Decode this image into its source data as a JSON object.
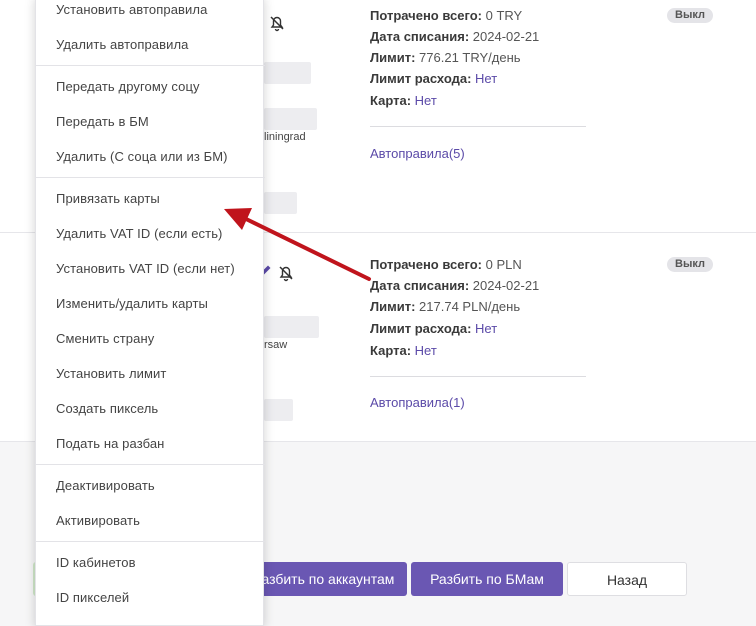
{
  "accounts": [
    {
      "spent_label": "Потрачено всего:",
      "spent_value": "0 TRY",
      "debit_label": "Дата списания:",
      "debit_value": "2024-02-21",
      "limit_label": "Лимит:",
      "limit_value": "776.21 TRY/день",
      "spend_limit_label": "Лимит расхода:",
      "spend_limit_value": "Нет",
      "card_label": "Карта:",
      "card_value": "Нет",
      "autorules_link": "Автоправила(5)",
      "status_badge": "Выкл",
      "location_partial": "liningrad"
    },
    {
      "spent_label": "Потрачено всего:",
      "spent_value": "0 PLN",
      "debit_label": "Дата списания:",
      "debit_value": "2024-02-21",
      "limit_label": "Лимит:",
      "limit_value": "217.74 PLN/день",
      "spend_limit_label": "Лимит расхода:",
      "spend_limit_value": "Нет",
      "card_label": "Карта:",
      "card_value": "Нет",
      "autorules_link": "Автоправила(1)",
      "status_badge": "Выкл",
      "location_partial": "rsaw"
    }
  ],
  "menu": {
    "groups": [
      [
        "Установить автоправила",
        "Удалить автоправила"
      ],
      [
        "Передать другому соцу",
        "Передать в БМ",
        "Удалить (С соца или из БМ)"
      ],
      [
        "Привязать карты",
        "Удалить VAT ID (если есть)",
        "Установить VAT ID (если нет)",
        "Изменить/удалить карты",
        "Сменить страну",
        "Установить лимит",
        "Создать пиксель",
        "Подать на разбан"
      ],
      [
        "Деактивировать",
        "Активировать"
      ],
      [
        "ID кабинетов",
        "ID пикселей"
      ]
    ]
  },
  "buttons": {
    "split_accounts": "Разбить по аккаунтам",
    "split_bms": "Разбить по БМам",
    "back": "Назад"
  },
  "colors": {
    "accent": "#6a57b3",
    "link": "#5b4aa8",
    "arrow": "#c0141c"
  },
  "icons": [
    "bell-off-icon",
    "pencil-icon"
  ]
}
